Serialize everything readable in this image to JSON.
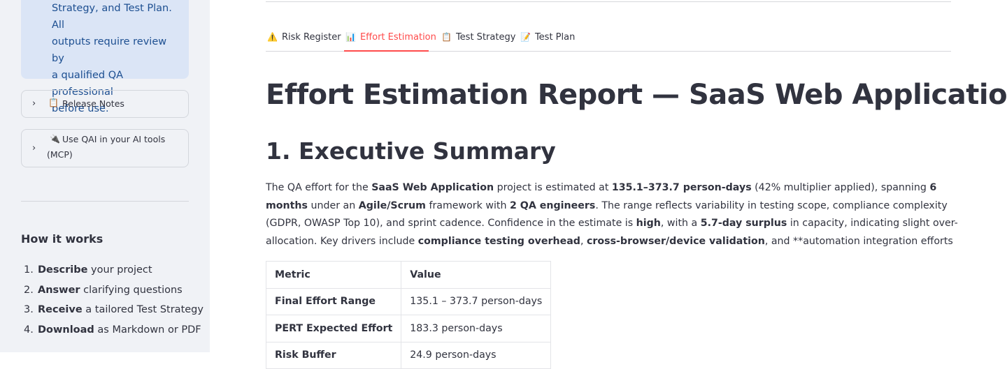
{
  "sidebar": {
    "info_lines": [
      "Strategy, and Test Plan. All",
      "outputs require review by",
      "a qualified QA professional",
      "before use."
    ],
    "expanders": [
      {
        "icon": "📋",
        "label": "Release Notes"
      },
      {
        "icon": "🔌",
        "label_line1": "Use QAI in your AI tools",
        "label_line2": "(MCP)"
      }
    ],
    "how_title": "How it works",
    "steps": [
      {
        "num": "1.",
        "bold": "Describe",
        "rest": " your project"
      },
      {
        "num": "2.",
        "bold": "Answer",
        "rest": " clarifying questions"
      },
      {
        "num": "3.",
        "bold": "Receive",
        "rest": " a tailored Test Strategy"
      },
      {
        "num": "4.",
        "bold": "Download",
        "rest": " as Markdown or PDF"
      }
    ]
  },
  "tabs": [
    {
      "icon": "⚠️",
      "label": "Risk Register",
      "active": false
    },
    {
      "icon": "📊",
      "label": "Effort Estimation",
      "active": true
    },
    {
      "icon": "📋",
      "label": "Test Strategy",
      "active": false
    },
    {
      "icon": "📝",
      "label": "Test Plan",
      "active": false
    }
  ],
  "report": {
    "title": "Effort Estimation Report — SaaS Web Application",
    "section_title": "1. Executive Summary",
    "summary": {
      "t1": "The QA effort for the ",
      "b1": "SaaS Web Application",
      "t2": " project is estimated at ",
      "b2": "135.1–373.7 person-days",
      "t3": " (42% multiplier applied), spanning ",
      "b3": "6 months",
      "t4": " under an ",
      "b4": "Agile/Scrum",
      "t5": " framework with ",
      "b5": "2 QA engineers",
      "t6": ". The range reflects variability in testing scope, compliance complexity (GDPR, OWASP Top 10), and sprint cadence. Confidence in the estimate is ",
      "b6": "high",
      "t7": ", with a ",
      "b7": "5.7-day surplus",
      "t8": " in capacity, indicating slight over-allocation. Key drivers include ",
      "b8": "compliance testing overhead",
      "t9": ", ",
      "b9": "cross-browser/device validation",
      "t10": ", and **automation integration efforts"
    },
    "table": {
      "headers": [
        "Metric",
        "Value"
      ],
      "rows": [
        {
          "metric": "Final Effort Range",
          "value": "135.1 – 373.7 person-days"
        },
        {
          "metric": "PERT Expected Effort",
          "value": "183.3 person-days"
        },
        {
          "metric": "Risk Buffer",
          "value": "24.9 person-days"
        }
      ]
    }
  },
  "colors": {
    "accent": "#ff4b4b",
    "info_bg": "#dbe5f6",
    "info_text": "#1d4f91",
    "sidebar_bg": "#f0f2f6"
  }
}
